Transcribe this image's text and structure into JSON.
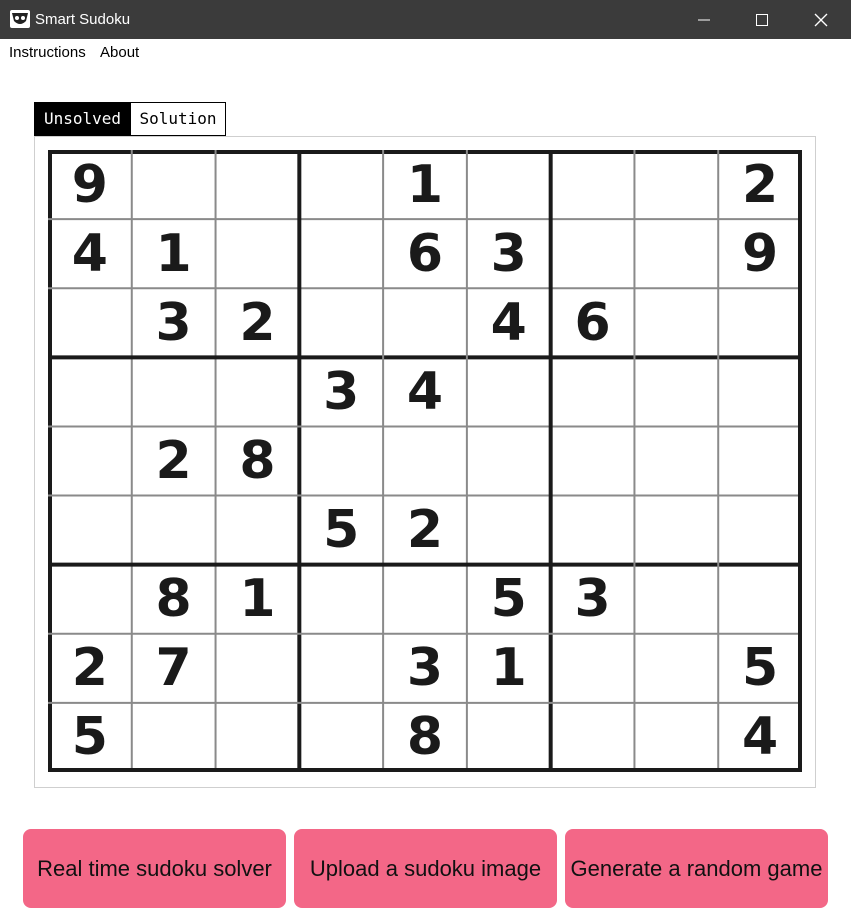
{
  "window": {
    "title": "Smart Sudoku",
    "controls": [
      "minimize",
      "maximize",
      "close"
    ]
  },
  "menu": [
    {
      "label": "Instructions"
    },
    {
      "label": "About"
    }
  ],
  "tabs": [
    {
      "label": "Unsolved",
      "active": true
    },
    {
      "label": "Solution",
      "active": false
    }
  ],
  "grid": [
    [
      9,
      0,
      0,
      0,
      1,
      0,
      0,
      0,
      2
    ],
    [
      4,
      1,
      0,
      0,
      6,
      3,
      0,
      0,
      9
    ],
    [
      0,
      3,
      2,
      0,
      0,
      4,
      6,
      0,
      0
    ],
    [
      0,
      0,
      0,
      3,
      4,
      0,
      0,
      0,
      0
    ],
    [
      0,
      2,
      8,
      0,
      0,
      0,
      0,
      0,
      0
    ],
    [
      0,
      0,
      0,
      5,
      2,
      0,
      0,
      0,
      0
    ],
    [
      0,
      8,
      1,
      0,
      0,
      5,
      3,
      0,
      0
    ],
    [
      2,
      7,
      0,
      0,
      3,
      1,
      0,
      0,
      5
    ],
    [
      5,
      0,
      0,
      0,
      8,
      0,
      0,
      0,
      4
    ]
  ],
  "buttons": [
    {
      "label": "Real time sudoku solver"
    },
    {
      "label": "Upload a sudoku image"
    },
    {
      "label": "Generate a random game"
    }
  ],
  "colors": {
    "titlebar": "#3b3b3b",
    "button": "#f36787",
    "tab_active": "#000000"
  }
}
